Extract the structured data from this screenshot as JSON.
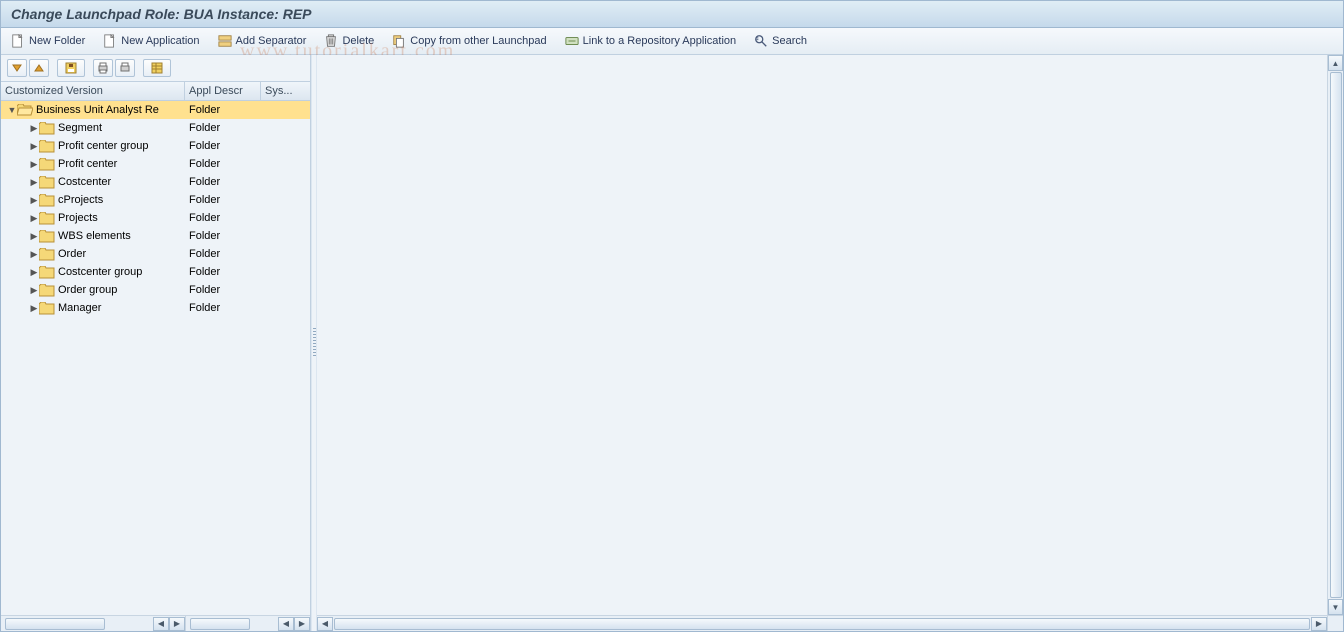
{
  "title": "Change Launchpad Role: BUA Instance: REP",
  "watermark": "www.tutorialkart.com",
  "toolbar": {
    "new_folder": "New Folder",
    "new_application": "New Application",
    "add_separator": "Add Separator",
    "delete": "Delete",
    "copy_from": "Copy from other Launchpad",
    "link_repo": "Link to a Repository Application",
    "search": "Search"
  },
  "columns": {
    "version": "Customized Version",
    "appl_descr": "Appl Descr",
    "sys": "Sys..."
  },
  "tree": {
    "root": {
      "label": "Business Unit Analyst Re",
      "descr": "Folder"
    },
    "children": [
      {
        "label": "Segment",
        "descr": "Folder"
      },
      {
        "label": "Profit center group",
        "descr": "Folder"
      },
      {
        "label": "Profit center",
        "descr": "Folder"
      },
      {
        "label": "Costcenter",
        "descr": "Folder"
      },
      {
        "label": "cProjects",
        "descr": "Folder"
      },
      {
        "label": "Projects",
        "descr": "Folder"
      },
      {
        "label": "WBS elements",
        "descr": "Folder"
      },
      {
        "label": "Order",
        "descr": "Folder"
      },
      {
        "label": "Costcenter group",
        "descr": "Folder"
      },
      {
        "label": "Order group",
        "descr": "Folder"
      },
      {
        "label": "Manager",
        "descr": "Folder"
      }
    ]
  }
}
